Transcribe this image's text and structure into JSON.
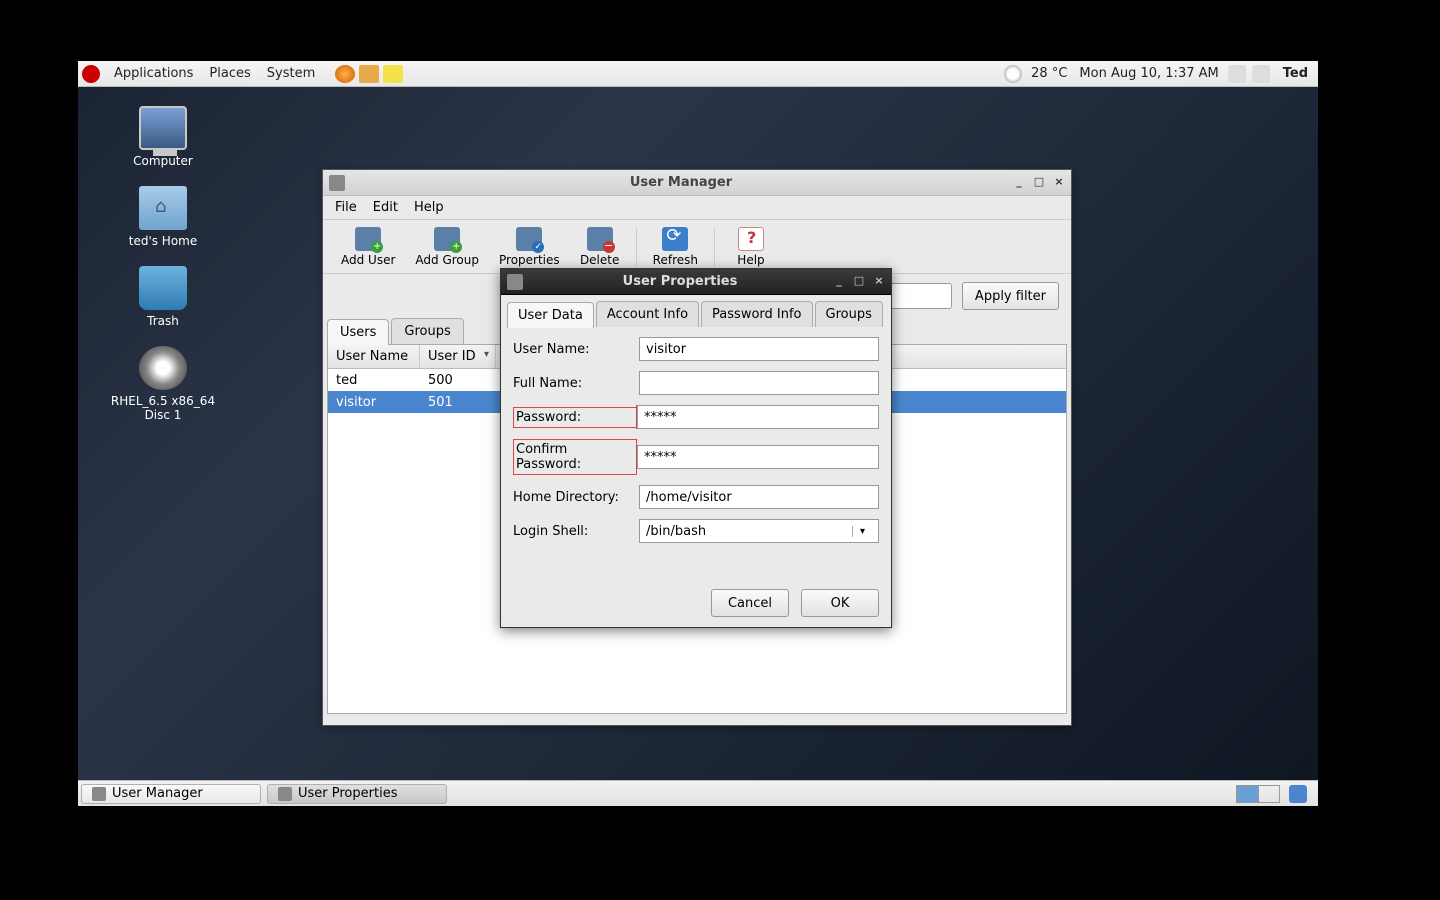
{
  "panel": {
    "menus": {
      "applications": "Applications",
      "places": "Places",
      "system": "System"
    },
    "temperature": "28 °C",
    "datetime": "Mon Aug 10,  1:37 AM",
    "user": "Ted"
  },
  "desktop_icons": {
    "computer": "Computer",
    "home": "ted's Home",
    "trash": "Trash",
    "disc": "RHEL_6.5 x86_64 Disc 1"
  },
  "user_manager": {
    "title": "User Manager",
    "menubar": {
      "file": "File",
      "edit": "Edit",
      "help": "Help"
    },
    "toolbar": {
      "add_user": "Add User",
      "add_group": "Add Group",
      "properties": "Properties",
      "delete": "Delete",
      "refresh": "Refresh",
      "help": "Help"
    },
    "apply_filter": "Apply filter",
    "tabs": {
      "users": "Users",
      "groups": "Groups"
    },
    "columns": {
      "username": "User Name",
      "userid": "User ID"
    },
    "rows": [
      {
        "name": "ted",
        "id": "500"
      },
      {
        "name": "visitor",
        "id": "501"
      }
    ]
  },
  "user_properties": {
    "title": "User Properties",
    "tabs": {
      "user_data": "User Data",
      "account_info": "Account Info",
      "password_info": "Password Info",
      "groups": "Groups"
    },
    "fields": {
      "username_label": "User Name:",
      "username": "visitor",
      "fullname_label": "Full Name:",
      "fullname": "",
      "password_label": "Password:",
      "password": "*****",
      "confirm_label": "Confirm Password:",
      "confirm": "*****",
      "home_label": "Home Directory:",
      "home": "/home/visitor",
      "shell_label": "Login Shell:",
      "shell": "/bin/bash"
    },
    "buttons": {
      "cancel": "Cancel",
      "ok": "OK"
    }
  },
  "taskbar": {
    "user_manager": "User Manager",
    "user_properties": "User Properties"
  }
}
